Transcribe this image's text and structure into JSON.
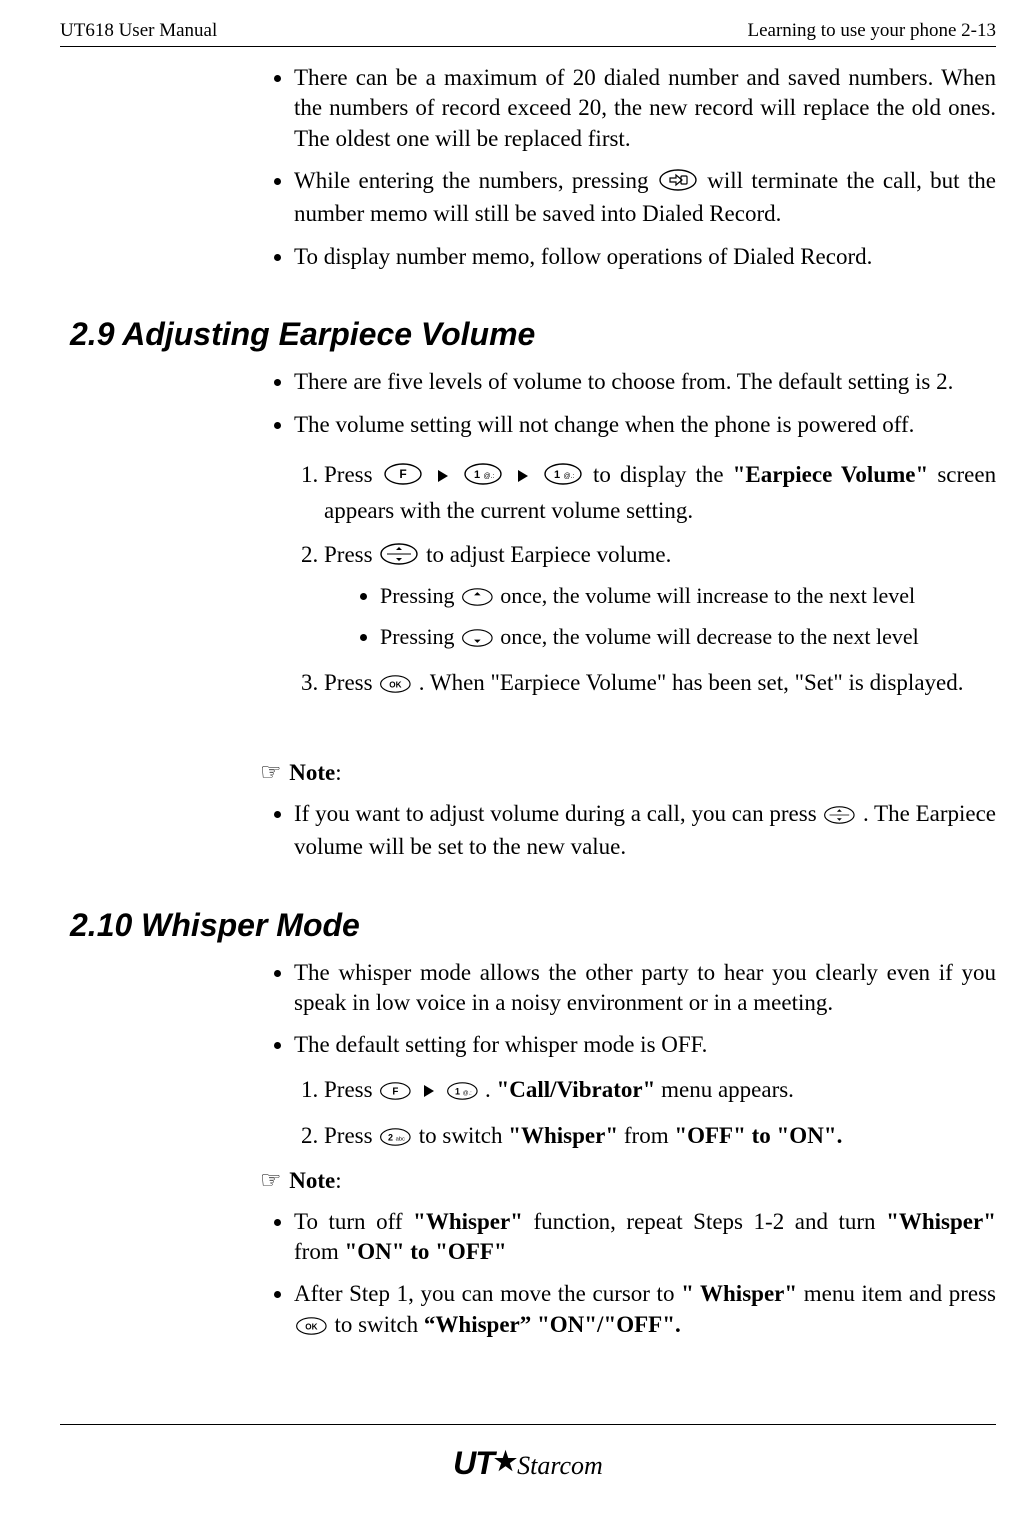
{
  "header": {
    "left": "UT618 User Manual",
    "right": "Learning to use your phone   2-13"
  },
  "top_bullets": [
    "There can be a maximum of 20 dialed number and saved numbers. When the numbers of record exceed 20, the new record will replace the old ones. The oldest one will be replaced first.",
    "While entering the numbers, pressing {END} will terminate the call, but the number memo will still be saved into Dialed Record.",
    "To display number memo, follow operations of Dialed Record."
  ],
  "sec_29": {
    "title": "2.9   Adjusting Earpiece Volume",
    "bullets_intro": [
      "There are five levels of volume to choose from. The default setting is 2.",
      "The volume setting will not change when the phone is powered off."
    ],
    "step1": {
      "prefix": "Press ",
      "mid": " to display the ",
      "bold": "\"Earpiece Volume\"",
      "suffix": " screen appears with the current volume setting."
    },
    "step2": "Press {NAV} to adjust Earpiece volume.",
    "step2_sub": [
      "Pressing {UP} once, the volume will increase to the next level",
      "Pressing {DOWN} once, the volume will decrease to the next level"
    ],
    "step3": "Press {OK}. When \"Earpiece Volume\" has been set, \"Set\" is displayed.",
    "note_label": "Note",
    "note_bullet": "If you want to adjust volume during a call, you can press {NAV}. The Earpiece volume will be set to the new value."
  },
  "sec_210": {
    "title": "2.10 Whisper Mode",
    "bullets_intro": [
      "The whisper mode allows the other party to hear you clearly even if you speak in low voice in a noisy environment or in a meeting.",
      "The default setting for whisper mode is OFF."
    ],
    "step1": {
      "prefix": "Press",
      "suffix1": ". ",
      "bold": "\"Call/Vibrator\"",
      "suffix2": " menu appears."
    },
    "step2": {
      "prefix": "Press ",
      "mid": " to switch ",
      "b1": "\"Whisper\"",
      "mid2": " from ",
      "b2": "\"OFF\" to \"ON\"."
    },
    "note_label": "Note",
    "note_b1": {
      "a": "To turn off ",
      "b": "\"Whisper\"",
      "c": " function, repeat Steps 1-2 and turn ",
      "d": "\"Whisper\"",
      "e": " from ",
      "f": "\"ON\" to \"OFF\""
    },
    "note_b2": {
      "a": "After Step 1, you can move the cursor to ",
      "b": "\" Whisper\"",
      "c": " menu item and press ",
      "d": " to switch ",
      "e": "“Whisper” \"ON\"/\"OFF\"."
    }
  },
  "logo": {
    "ut": "UT",
    "starcom": "Starcom"
  }
}
